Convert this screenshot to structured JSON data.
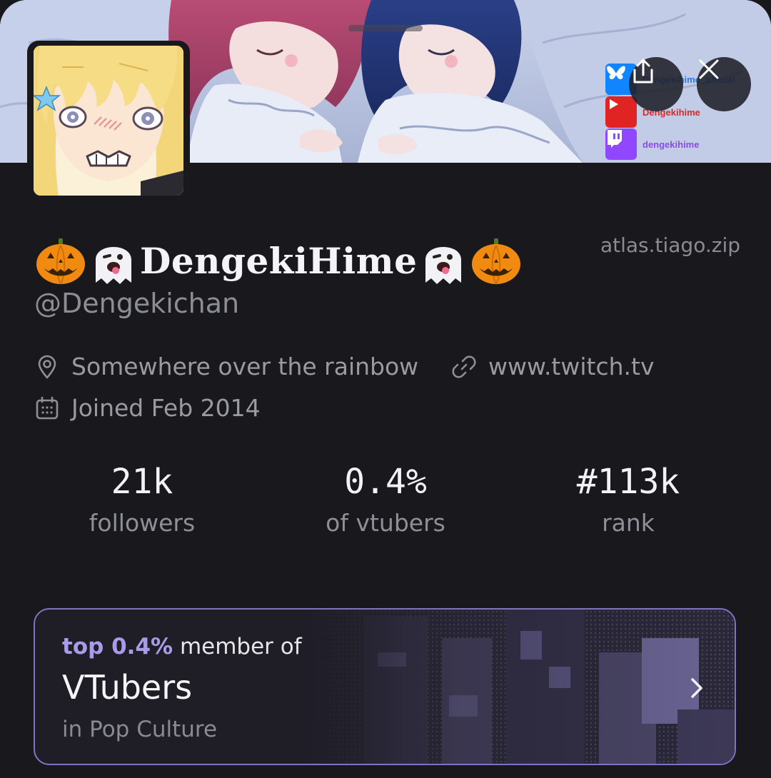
{
  "banner": {
    "social_links": [
      {
        "icon": "bluesky-icon",
        "label": "Dengekihime_official",
        "color": "#1185fe"
      },
      {
        "icon": "youtube-icon",
        "label": "Dengekihime",
        "color": "#e02424"
      },
      {
        "icon": "twitch-icon",
        "label": "dengekihime",
        "color": "#9146ff"
      }
    ]
  },
  "actions": {
    "share_icon": "share-icon",
    "close_icon": "close-icon"
  },
  "profile": {
    "display_name": "DengekiHime",
    "emojis": [
      "jack-o-lantern",
      "ghost",
      "ghost",
      "jack-o-lantern"
    ],
    "handle": "@Dengekichan",
    "site": "atlas.tiago.zip",
    "location": "Somewhere over the rainbow",
    "link": "www.twitch.tv",
    "joined": "Joined Feb 2014"
  },
  "stats": [
    {
      "value": "21k",
      "label": "followers"
    },
    {
      "value": "0.4%",
      "label": "of vtubers"
    },
    {
      "value": "#113k",
      "label": "rank"
    }
  ],
  "community": {
    "rank_prefix": "top 0.4%",
    "rank_suffix": "member of",
    "name": "VTubers",
    "category": "in Pop Culture",
    "accent_color": "#a99be8",
    "border_color": "#7f74c4"
  }
}
